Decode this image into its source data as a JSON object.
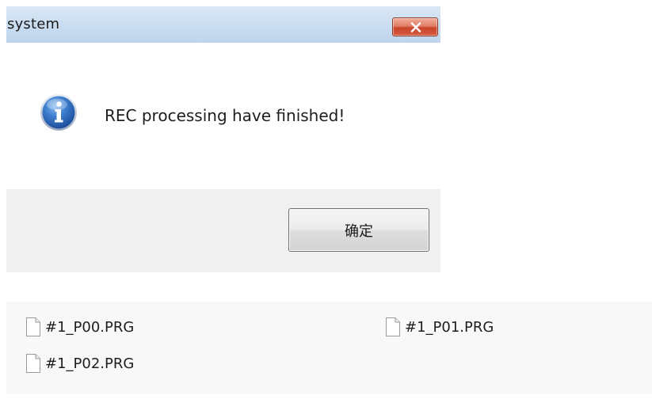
{
  "dialog": {
    "title": "system",
    "message": "REC processing have finished!",
    "ok_label": "确定",
    "icons": {
      "close": "close-icon",
      "info": "info-icon"
    }
  },
  "files": {
    "icon": "document-icon",
    "items": [
      {
        "name": "#1_P00.PRG"
      },
      {
        "name": "#1_P01.PRG"
      },
      {
        "name": "#1_P02.PRG"
      }
    ]
  },
  "colors": {
    "titlebar": "#c9dcf0",
    "close_button": "#d65b3f",
    "info_icon": "#2f6fc4",
    "footer": "#f0f0f0"
  }
}
